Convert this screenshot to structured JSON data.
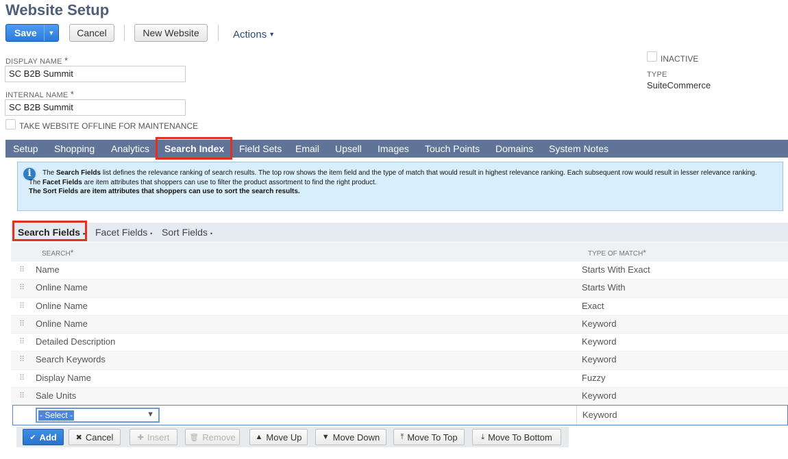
{
  "header": {
    "title": "Website Setup",
    "save_label": "Save",
    "save_arrow": "▼",
    "cancel_label": "Cancel",
    "new_website_label": "New Website",
    "actions_label": "Actions",
    "actions_caret": "▼"
  },
  "form": {
    "display_name_label": "DISPLAY NAME",
    "display_name_value": "SC B2B Summit",
    "internal_name_label": "INTERNAL NAME",
    "internal_name_value": "SC B2B Summit",
    "required_mark": "*",
    "offline_label": "TAKE WEBSITE OFFLINE FOR MAINTENANCE",
    "offline_checked": false,
    "inactive_label": "INACTIVE",
    "inactive_checked": false,
    "type_label": "TYPE",
    "type_value": "SuiteCommerce"
  },
  "tabs": [
    {
      "label": "Setup",
      "active": false
    },
    {
      "label": "Shopping",
      "active": false
    },
    {
      "label": "Analytics",
      "active": false
    },
    {
      "label": "Search Index",
      "active": true
    },
    {
      "label": "Field Sets",
      "active": false
    },
    {
      "label": "Email",
      "active": false
    },
    {
      "label": "Upsell",
      "active": false
    },
    {
      "label": "Images",
      "active": false
    },
    {
      "label": "Touch Points",
      "active": false
    },
    {
      "label": "Domains",
      "active": false
    },
    {
      "label": "System Notes",
      "active": false
    }
  ],
  "info": {
    "icon": "i",
    "l1_pre": "The ",
    "l1_bold": "Search Fields",
    "l1_post": " list defines the relevance ranking of search results. The top row shows the item field and the type of match that would result in highest relevance ranking. Each subsequent row would result in lesser relevance ranking.",
    "l2_pre": "The ",
    "l2_bold": "Facet Fields",
    "l2_post": " are item attributes that shoppers can use to filter the product assortment to find the right product.",
    "l3": "The Sort Fields are item attributes that shoppers can use to sort the search results."
  },
  "subtabs": [
    {
      "label": "Search Fields",
      "active": true
    },
    {
      "label": "Facet Fields",
      "active": false
    },
    {
      "label": "Sort Fields",
      "active": false
    }
  ],
  "subtab_dot": "•",
  "grid": {
    "col_search": "SEARCH",
    "col_match": "TYPE OF MATCH",
    "required_mark": "*",
    "drag_glyph": "⠿",
    "rows": [
      {
        "search": "Name",
        "match": "Starts With Exact"
      },
      {
        "search": "Online Name",
        "match": "Starts With"
      },
      {
        "search": "Online Name",
        "match": "Exact"
      },
      {
        "search": "Online Name",
        "match": "Keyword"
      },
      {
        "search": "Detailed Description",
        "match": "Keyword"
      },
      {
        "search": "Search Keywords",
        "match": "Keyword"
      },
      {
        "search": "Display Name",
        "match": "Fuzzy"
      },
      {
        "search": "Sale Units",
        "match": "Keyword"
      }
    ],
    "edit_row": {
      "select_value": "- Select -",
      "match": "Keyword"
    }
  },
  "actionbar": {
    "add": {
      "icon": "✔",
      "label": "Add"
    },
    "cancel": {
      "icon": "✖",
      "label": "Cancel"
    },
    "insert": {
      "icon": "✚",
      "label": "Insert"
    },
    "remove": {
      "icon": "🗑",
      "label": "Remove"
    },
    "move_up": {
      "icon": "▲",
      "label": "Move Up"
    },
    "move_down": {
      "icon": "▼",
      "label": "Move Down"
    },
    "move_top": {
      "icon": "⤒",
      "label": "Move To Top"
    },
    "move_bottom": {
      "icon": "⤓",
      "label": "Move To Bottom"
    }
  },
  "colors": {
    "tab_bar": "#607497",
    "highlight_box": "#e0301e",
    "save_button": "#2d7ad8",
    "info_background": "#d9eefb"
  }
}
